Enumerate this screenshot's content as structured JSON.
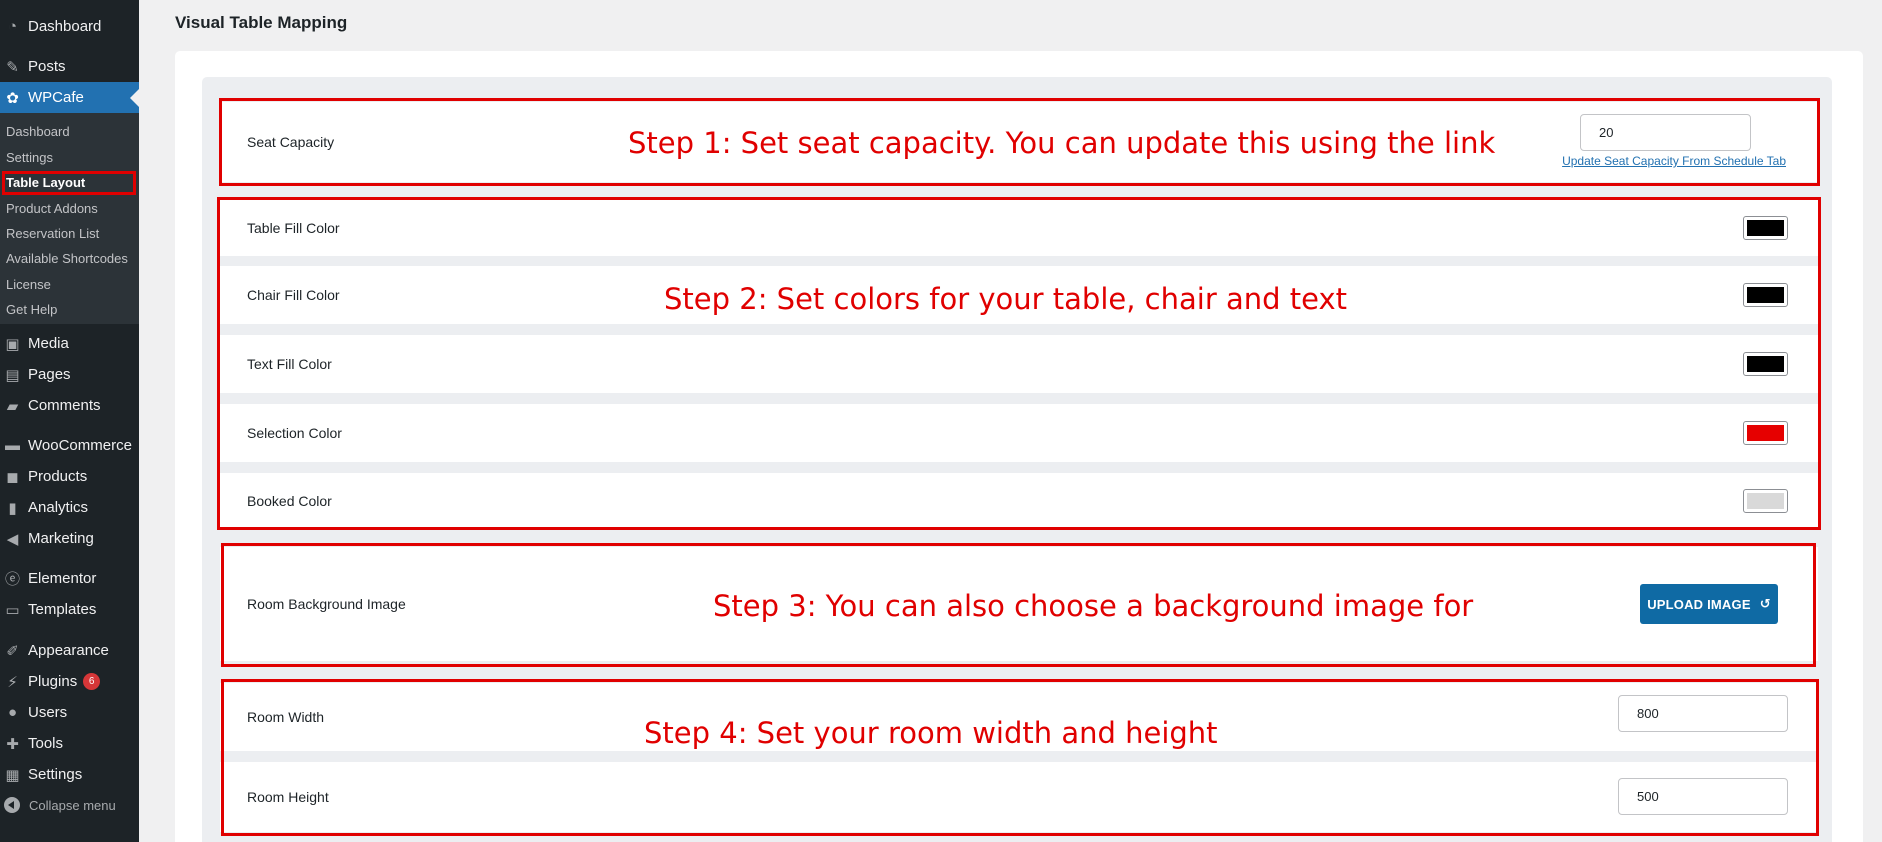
{
  "sidebar": {
    "menu": [
      {
        "label": "Dashboard",
        "icon": "dashboard-icon"
      },
      {
        "label": "Posts",
        "icon": "pin-icon"
      },
      {
        "label": "WPCafe",
        "icon": "wpcafe-icon"
      },
      {
        "label": "Media",
        "icon": "media-icon"
      },
      {
        "label": "Pages",
        "icon": "pages-icon"
      },
      {
        "label": "Comments",
        "icon": "comments-icon"
      },
      {
        "label": "WooCommerce",
        "icon": "woo-icon"
      },
      {
        "label": "Products",
        "icon": "products-icon"
      },
      {
        "label": "Analytics",
        "icon": "analytics-icon"
      },
      {
        "label": "Marketing",
        "icon": "marketing-icon"
      },
      {
        "label": "Elementor",
        "icon": "elementor-icon"
      },
      {
        "label": "Templates",
        "icon": "folder-icon"
      },
      {
        "label": "Appearance",
        "icon": "appearance-icon"
      },
      {
        "label": "Plugins",
        "icon": "plugins-icon",
        "badge": "6"
      },
      {
        "label": "Users",
        "icon": "users-icon"
      },
      {
        "label": "Tools",
        "icon": "tools-icon"
      },
      {
        "label": "Settings",
        "icon": "settings-icon"
      }
    ],
    "submenu": [
      {
        "label": "Dashboard"
      },
      {
        "label": "Settings"
      },
      {
        "label": "Table Layout"
      },
      {
        "label": "Product Addons"
      },
      {
        "label": "Reservation List"
      },
      {
        "label": "Available Shortcodes"
      },
      {
        "label": "License"
      },
      {
        "label": "Get Help"
      }
    ],
    "collapse_label": "Collapse menu"
  },
  "page": {
    "title": "Visual Table Mapping"
  },
  "fields": {
    "seat_capacity": {
      "label": "Seat Capacity",
      "value": "20",
      "link": "Update Seat Capacity From Schedule Tab"
    },
    "table_fill": {
      "label": "Table Fill Color",
      "color": "#000000"
    },
    "chair_fill": {
      "label": "Chair Fill Color",
      "color": "#000000"
    },
    "text_fill": {
      "label": "Text Fill Color",
      "color": "#000000"
    },
    "selection": {
      "label": "Selection Color",
      "color": "#e60000"
    },
    "booked": {
      "label": "Booked Color",
      "color": "#d9d9d9"
    },
    "background": {
      "label": "Room Background Image",
      "button": "UPLOAD IMAGE"
    },
    "room_width": {
      "label": "Room Width",
      "value": "800"
    },
    "room_height": {
      "label": "Room Height",
      "value": "500"
    }
  },
  "annotations": {
    "step1": "Step 1: Set seat capacity. You can update this using the link",
    "step2": "Step 2: Set colors for your table, chair and text",
    "step3": "Step 3:  You can also choose a background image for",
    "step4": "Step 4: Set your room width and height"
  },
  "colors": {
    "sidebar_bg": "#1d2327",
    "accent": "#2271b1",
    "annotation_red": "#e00000",
    "button_blue": "#0f6aa4"
  }
}
